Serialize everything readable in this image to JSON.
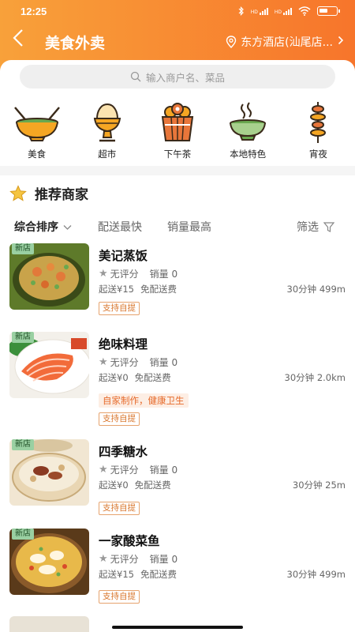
{
  "status": {
    "time": "12:25",
    "signal1": "HD",
    "signal2": "HD",
    "icons": [
      "bluetooth-icon",
      "signal-icon",
      "signal-icon",
      "wifi-icon",
      "battery-icon"
    ]
  },
  "nav": {
    "title": "美食外卖",
    "location": "东方酒店(汕尾店...",
    "back_icon": "back-arrow-icon",
    "location_icon": "location-pin-icon",
    "chevron_icon": "chevron-right-icon"
  },
  "search": {
    "placeholder": "输入商户名、菜品",
    "icon": "search-icon"
  },
  "categories": [
    {
      "label": "美食",
      "icon": "bowl-chopsticks-icon"
    },
    {
      "label": "超市",
      "icon": "egg-cup-icon"
    },
    {
      "label": "下午茶",
      "icon": "pastry-box-icon"
    },
    {
      "label": "本地特色",
      "icon": "steaming-bowl-icon"
    },
    {
      "label": "宵夜",
      "icon": "skewer-icon"
    }
  ],
  "section": {
    "title": "推荐商家",
    "icon": "star-icon"
  },
  "sort": {
    "options": [
      "综合排序",
      "配送最快",
      "销量最高"
    ],
    "filter": "筛选",
    "active_index": 0
  },
  "shops": [
    {
      "badge": "新店",
      "name": "美记蒸饭",
      "rating": "无评分",
      "sales": "销量 0",
      "min_order": "起送¥15",
      "delivery_fee": "免配送费",
      "eta": "30分钟 499m",
      "slogan": "",
      "tag": "支持自提"
    },
    {
      "badge": "新店",
      "name": "绝味料理",
      "rating": "无评分",
      "sales": "销量 0",
      "min_order": "起送¥0",
      "delivery_fee": "免配送费",
      "eta": "30分钟 2.0km",
      "slogan": "自家制作，健康卫生",
      "tag": "支持自提"
    },
    {
      "badge": "新店",
      "name": "四季糖水",
      "rating": "无评分",
      "sales": "销量 0",
      "min_order": "起送¥0",
      "delivery_fee": "免配送费",
      "eta": "30分钟 25m",
      "slogan": "",
      "tag": "支持自提"
    },
    {
      "badge": "新店",
      "name": "一家酸菜鱼",
      "rating": "无评分",
      "sales": "销量 0",
      "min_order": "起送¥15",
      "delivery_fee": "免配送费",
      "eta": "30分钟 499m",
      "slogan": "",
      "tag": "支持自提"
    }
  ],
  "colors": {
    "header_start": "#f8a13a",
    "header_end": "#f7752b",
    "tag_border": "#e6a36e",
    "badge_bg": "#9ad0a2"
  }
}
